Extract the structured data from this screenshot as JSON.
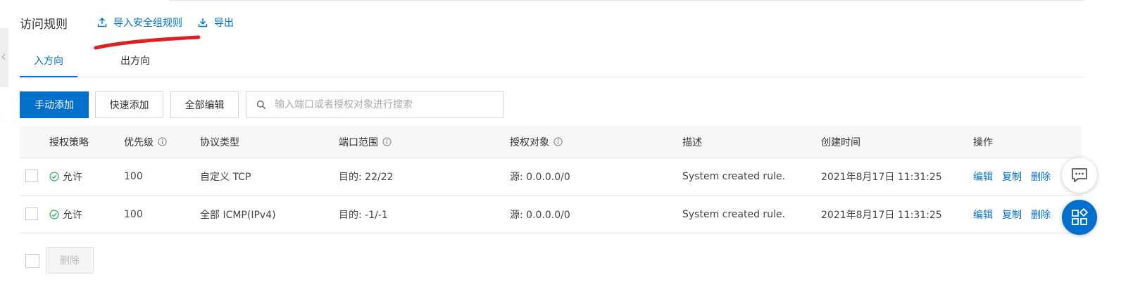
{
  "header": {
    "title": "访问规则",
    "import_label": "导入安全组规则",
    "export_label": "导出"
  },
  "tabs": [
    {
      "label": "入方向",
      "active": true
    },
    {
      "label": "出方向",
      "active": false
    }
  ],
  "toolbar": {
    "manual_add": "手动添加",
    "quick_add": "快速添加",
    "edit_all": "全部编辑",
    "search_placeholder": "输入端口或者授权对象进行搜索"
  },
  "table": {
    "columns": {
      "policy": "授权策略",
      "priority": "优先级",
      "protocol": "协议类型",
      "port": "端口范围",
      "object": "授权对象",
      "description": "描述",
      "created": "创建时间",
      "actions": "操作"
    },
    "rows": [
      {
        "policy": "允许",
        "priority": "100",
        "protocol": "自定义 TCP",
        "port": "目的: 22/22",
        "object": "源: 0.0.0.0/0",
        "description": "System created rule.",
        "created": "2021年8月17日 11:31:25",
        "edit": "编辑",
        "copy": "复制",
        "delete": "删除"
      },
      {
        "policy": "允许",
        "priority": "100",
        "protocol": "全部 ICMP(IPv4)",
        "port": "目的: -1/-1",
        "object": "源: 0.0.0.0/0",
        "description": "System created rule.",
        "created": "2021年8月17日 11:31:25",
        "edit": "编辑",
        "copy": "复制",
        "delete": "删除"
      }
    ]
  },
  "footer": {
    "delete_label": "删除"
  },
  "colors": {
    "accent": "#0070cc",
    "success": "#21a853",
    "annotation": "#e02020"
  }
}
